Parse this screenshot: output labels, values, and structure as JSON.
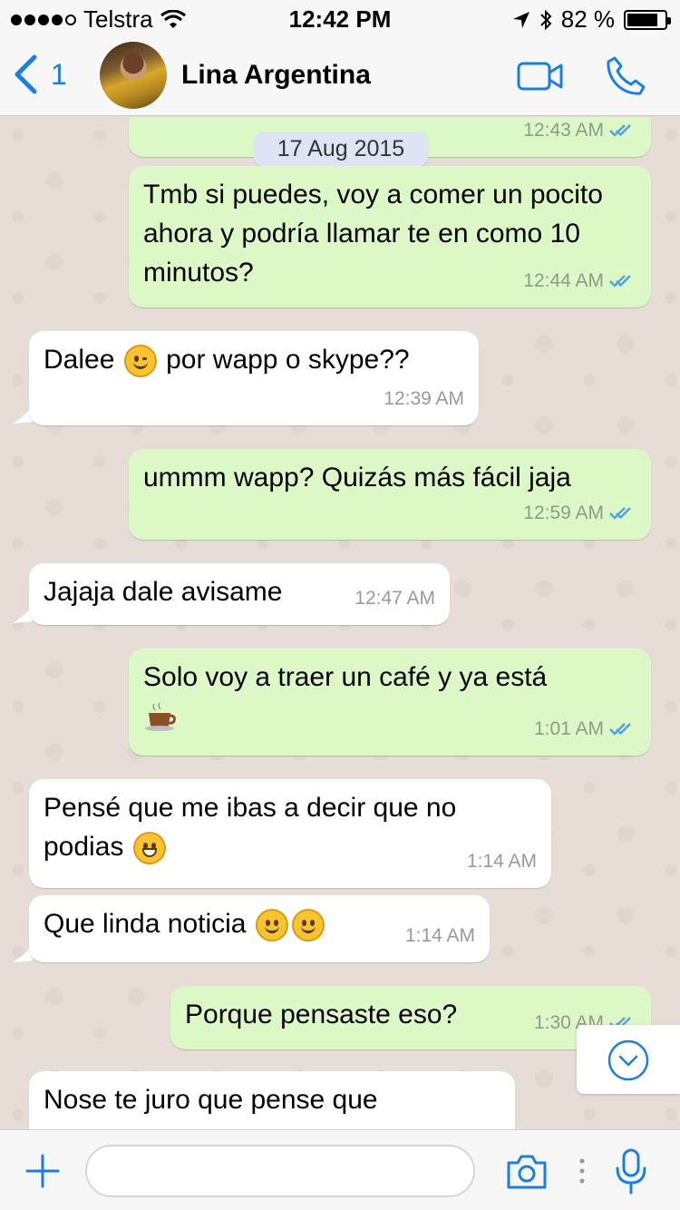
{
  "status_bar": {
    "carrier": "Telstra",
    "time": "12:42 PM",
    "battery_text": "82 %",
    "battery_level": 0.82,
    "signal_bars_filled": 4,
    "signal_bars_total": 5
  },
  "nav": {
    "back_count": "1",
    "contact_name": "Lina Argentina",
    "icons": [
      "chevron-left-icon",
      "video-call-icon",
      "phone-icon"
    ]
  },
  "chat": {
    "date_label": "17 Aug 2015",
    "messages": [
      {
        "dir": "out",
        "text": "",
        "time": "12:43 AM",
        "ticks": "read"
      },
      {
        "dir": "out",
        "text": "Tmb si puedes, voy a comer un pocito ahora y podría llamar te en como 10 minutos?",
        "time": "12:44 AM",
        "ticks": "read"
      },
      {
        "dir": "in",
        "text_before": "Dalee",
        "emoji": "winking-face",
        "text_after": "por wapp o skype??",
        "time": "12:39 AM"
      },
      {
        "dir": "out",
        "text": "ummm wapp? Quizás más fácil jaja",
        "time": "12:59 AM",
        "ticks": "read"
      },
      {
        "dir": "in",
        "text": "Jajaja dale avisame",
        "time": "12:47 AM"
      },
      {
        "dir": "out",
        "text": "Solo voy a traer un café y ya está",
        "emoji": "coffee",
        "time": "1:01 AM",
        "ticks": "read"
      },
      {
        "dir": "in",
        "text_line1": "Pensé que me ibas a decir que no",
        "text_line2": "podias",
        "emoji": "grinning-face",
        "time": "1:14 AM"
      },
      {
        "dir": "in",
        "text": "Que linda noticia",
        "emoji": "smiling-face",
        "time": "1:14 AM"
      },
      {
        "dir": "out",
        "text": "Porque pensaste eso?",
        "time": "1:30 AM",
        "ticks": "read"
      },
      {
        "dir": "in",
        "text": "Nose te juro que pense que",
        "time": ""
      }
    ]
  },
  "input": {
    "placeholder": "",
    "icons": [
      "plus-icon",
      "camera-icon",
      "more-icon",
      "microphone-icon"
    ]
  },
  "colors": {
    "accent": "#1b7ee0",
    "outgoing_bubble": "#dcf8c6",
    "incoming_bubble": "#ffffff",
    "read_ticks": "#4fa3e6",
    "chat_background": "#e6ded6"
  }
}
